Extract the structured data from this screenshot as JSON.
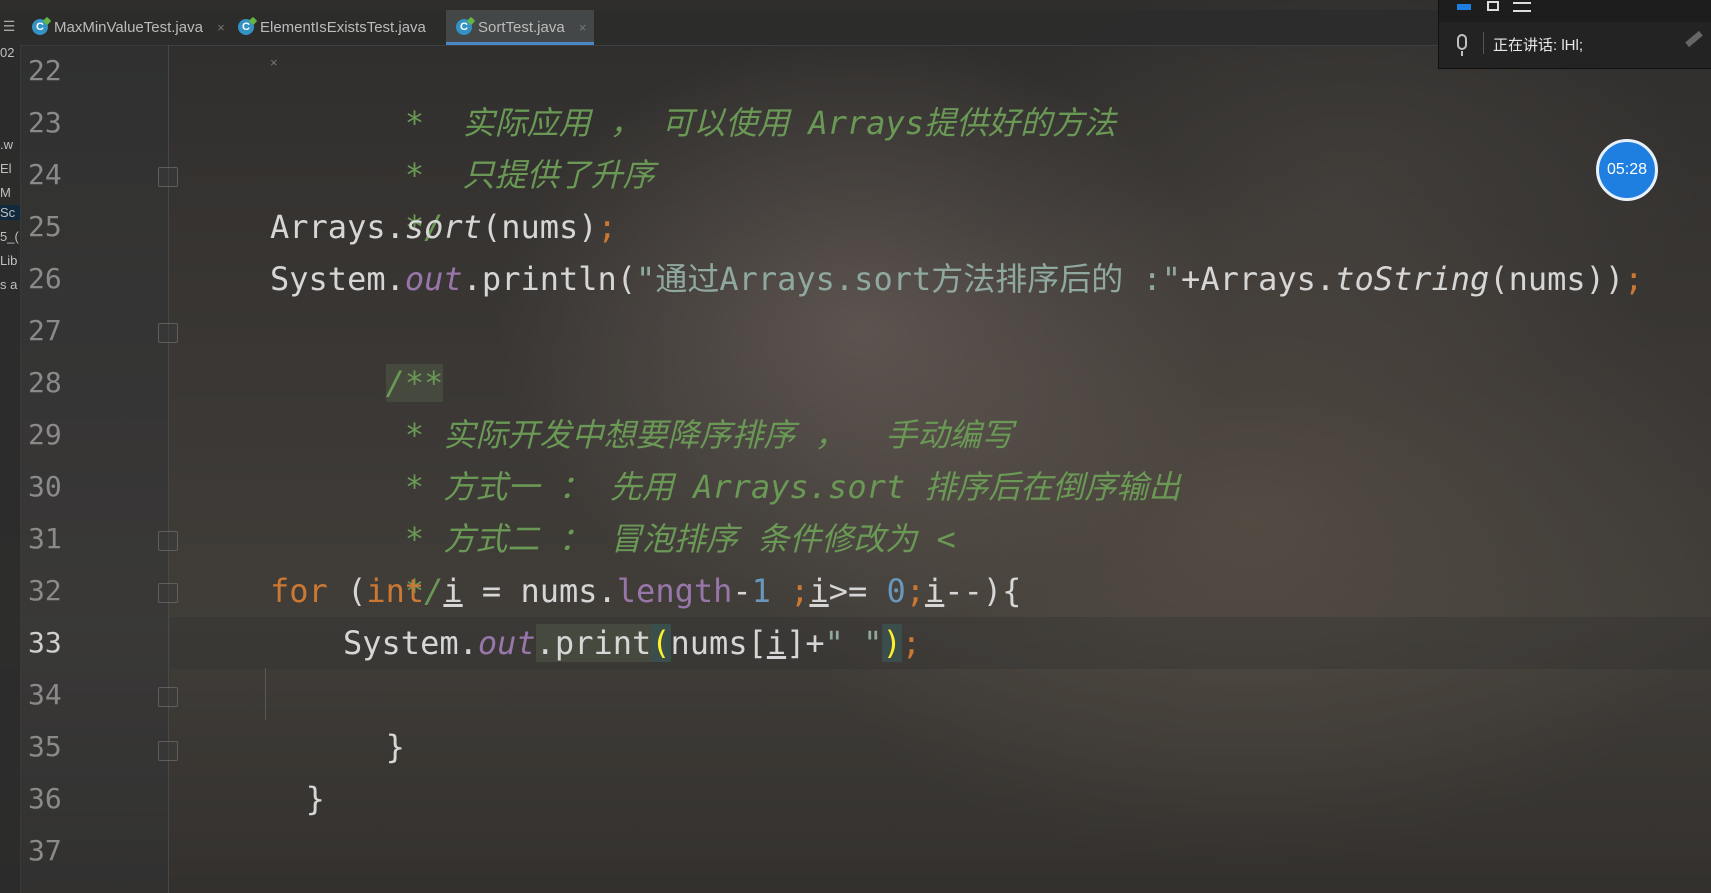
{
  "tabs": [
    {
      "label": "MaxMinValueTest.java",
      "active": false
    },
    {
      "label": "ElementIsExistsTest.java",
      "active": false
    },
    {
      "label": "SortTest.java",
      "active": true
    }
  ],
  "tab_close_glyph": "×",
  "left_strip": {
    "fragments": [
      "02",
      ".w",
      "El",
      "M",
      "Sc",
      "5_(",
      "Lib",
      "s a"
    ]
  },
  "line_numbers": [
    "22",
    "23",
    "24",
    "25",
    "26",
    "27",
    "28",
    "29",
    "30",
    "31",
    "32",
    "33",
    "34",
    "35",
    "36",
    "37"
  ],
  "current_line": "33",
  "code": {
    "l22": " *  实际应用 ， 可以使用 Arrays提供好的方法",
    "l23": " *  只提供了升序",
    "l24": " */",
    "l25_a": "Arrays.",
    "l25_b": "sort",
    "l25_c": "(nums)",
    "l25_d": ";",
    "l26_a": "System.",
    "l26_b": "out",
    "l26_c": ".println(",
    "l26_d": "\"通过Arrays.sort方法排序后的 :\"",
    "l26_e": "+Arrays.",
    "l26_f": "toString",
    "l26_g": "(nums))",
    "l26_h": ";",
    "l27": "/**",
    "l28": " * 实际开发中想要降序排序 ，  手动编写",
    "l29": " * 方式一 ： 先用 Arrays.sort 排序后在倒序输出",
    "l30": " * 方式二 ： 冒泡排序 条件修改为 <",
    "l31": " */",
    "l32_for": "for",
    "l32_a": " (",
    "l32_int": "int",
    "l32_sp": " ",
    "l32_i1": "i",
    "l32_b": " = nums.",
    "l32_len": "length",
    "l32_c": "-",
    "l32_one": "1",
    "l32_d": " ",
    "l32_semi1": ";",
    "l32_i2": "i",
    "l32_e": ">= ",
    "l32_zero": "0",
    "l32_semi2": ";",
    "l32_i3": "i",
    "l32_f": "--){",
    "l33_a": "System.",
    "l33_b": "out",
    "l33_c": ".print",
    "l33_p1": "(",
    "l33_d": "nums[",
    "l33_i": "i",
    "l33_e": "]+",
    "l33_str": "\" \"",
    "l33_p2": ")",
    "l33_semi": ";",
    "l34": "}",
    "l35": "}"
  },
  "timer": "05:28",
  "meeting": {
    "speaking_label": "正在讲话:  lHl;"
  },
  "colors": {
    "keyword": "#cc7832",
    "comment": "#6a9955",
    "number": "#6897bb",
    "field": "#9876aa",
    "accent": "#1e7fe0"
  }
}
